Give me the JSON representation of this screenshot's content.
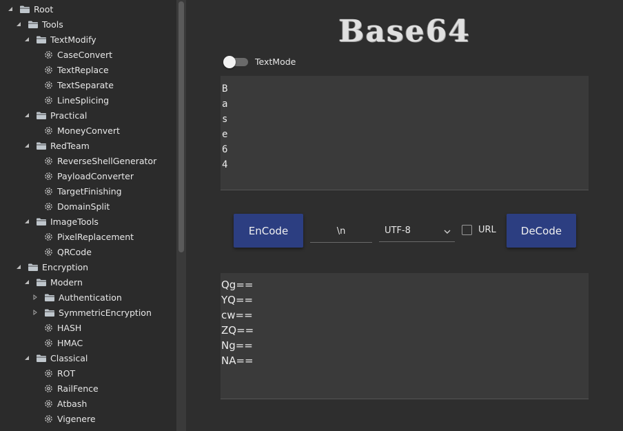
{
  "sidebar": {
    "items": [
      {
        "label": "Root",
        "depth": 0,
        "type": "folder",
        "expanded": true
      },
      {
        "label": "Tools",
        "depth": 1,
        "type": "folder",
        "expanded": true
      },
      {
        "label": "TextModify",
        "depth": 2,
        "type": "folder",
        "expanded": true
      },
      {
        "label": "CaseConvert",
        "depth": 3,
        "type": "leaf"
      },
      {
        "label": "TextReplace",
        "depth": 3,
        "type": "leaf"
      },
      {
        "label": "TextSeparate",
        "depth": 3,
        "type": "leaf"
      },
      {
        "label": "LineSplicing",
        "depth": 3,
        "type": "leaf"
      },
      {
        "label": "Practical",
        "depth": 2,
        "type": "folder",
        "expanded": true
      },
      {
        "label": "MoneyConvert",
        "depth": 3,
        "type": "leaf"
      },
      {
        "label": "RedTeam",
        "depth": 2,
        "type": "folder",
        "expanded": true
      },
      {
        "label": "ReverseShellGenerator",
        "depth": 3,
        "type": "leaf"
      },
      {
        "label": "PayloadConverter",
        "depth": 3,
        "type": "leaf"
      },
      {
        "label": "TargetFinishing",
        "depth": 3,
        "type": "leaf"
      },
      {
        "label": "DomainSplit",
        "depth": 3,
        "type": "leaf"
      },
      {
        "label": "ImageTools",
        "depth": 2,
        "type": "folder",
        "expanded": true
      },
      {
        "label": "PixelReplacement",
        "depth": 3,
        "type": "leaf"
      },
      {
        "label": "QRCode",
        "depth": 3,
        "type": "leaf"
      },
      {
        "label": "Encryption",
        "depth": 1,
        "type": "folder",
        "expanded": true
      },
      {
        "label": "Modern",
        "depth": 2,
        "type": "folder",
        "expanded": true
      },
      {
        "label": "Authentication",
        "depth": 3,
        "type": "folder",
        "expanded": false
      },
      {
        "label": "SymmetricEncryption",
        "depth": 3,
        "type": "folder",
        "expanded": false
      },
      {
        "label": "HASH",
        "depth": 3,
        "type": "leaf"
      },
      {
        "label": "HMAC",
        "depth": 3,
        "type": "leaf"
      },
      {
        "label": "Classical",
        "depth": 2,
        "type": "folder",
        "expanded": true
      },
      {
        "label": "ROT",
        "depth": 3,
        "type": "leaf"
      },
      {
        "label": "RailFence",
        "depth": 3,
        "type": "leaf"
      },
      {
        "label": "Atbash",
        "depth": 3,
        "type": "leaf"
      },
      {
        "label": "Vigenere",
        "depth": 3,
        "type": "leaf"
      }
    ]
  },
  "main": {
    "title": "Base64",
    "text_mode_label": "TextMode",
    "text_mode_on": false,
    "input_lines": [
      "B",
      "a",
      "s",
      "e",
      "6",
      "4"
    ],
    "encode_label": "EnCode",
    "decode_label": "DeCode",
    "separator_value": "\\n",
    "encoding_value": "UTF-8",
    "url_label": "URL",
    "url_checked": false,
    "output_lines": [
      "Qg==",
      "YQ==",
      "cw==",
      "ZQ==",
      "Ng==",
      "NA=="
    ]
  },
  "colors": {
    "background": "#2e2e2e",
    "sidebar_bg": "#2b2b2b",
    "button_accent": "#2c3e81",
    "textarea_bg": "#3a3a3a"
  }
}
